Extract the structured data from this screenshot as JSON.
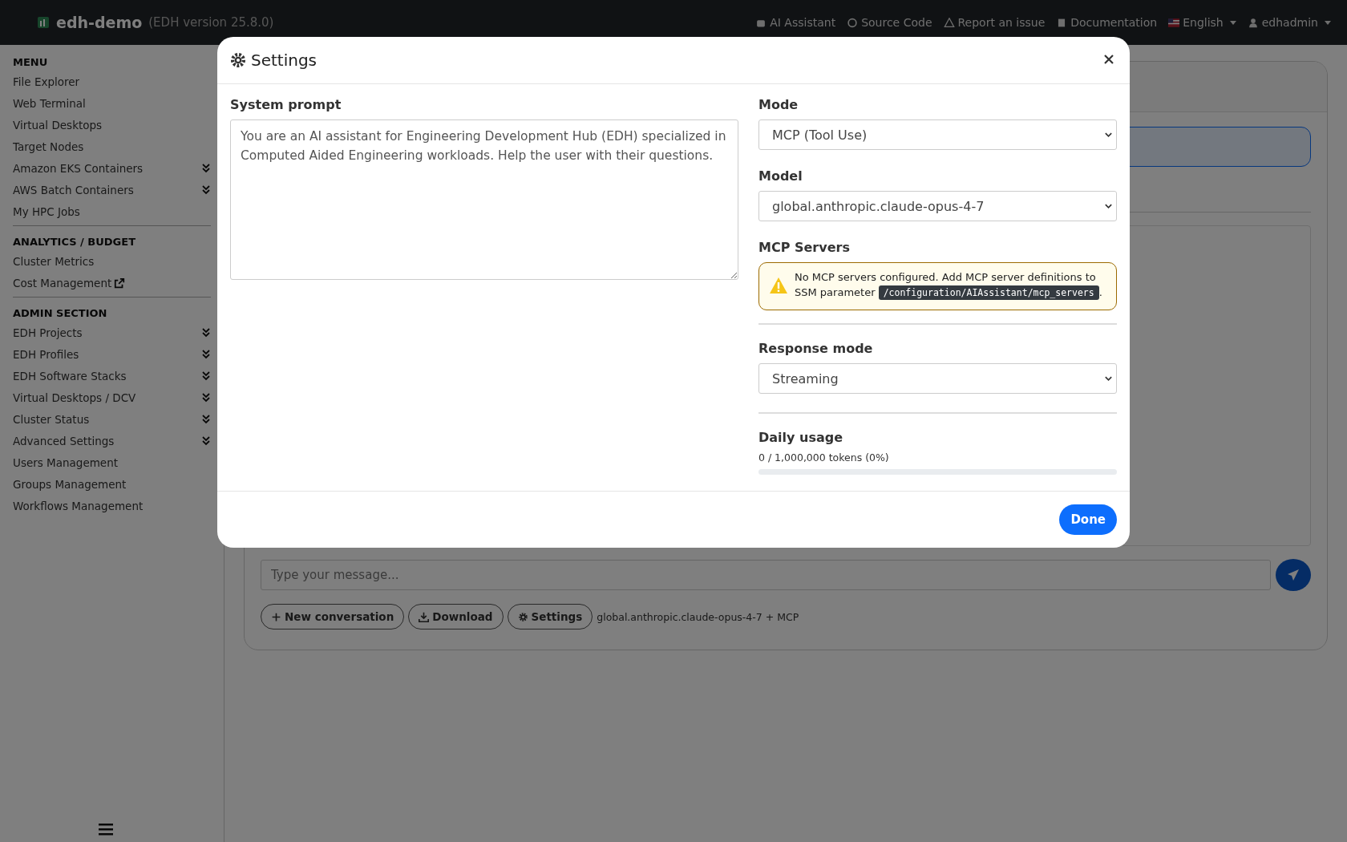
{
  "navbar": {
    "brand": "edh-demo",
    "version": "(EDH version 25.8.0)",
    "links": [
      {
        "label": "AI Assistant"
      },
      {
        "label": "Source Code"
      },
      {
        "label": "Report an issue"
      },
      {
        "label": "Documentation"
      }
    ],
    "language": "English",
    "user": "edhadmin"
  },
  "sidebar": {
    "sections": [
      {
        "title": "MENU",
        "items": [
          {
            "label": "File Explorer",
            "expandable": false,
            "external": false
          },
          {
            "label": "Web Terminal",
            "expandable": false,
            "external": false
          },
          {
            "label": "Virtual Desktops",
            "expandable": false,
            "external": false
          },
          {
            "label": "Target Nodes",
            "expandable": false,
            "external": false
          },
          {
            "label": "Amazon EKS Containers",
            "expandable": true,
            "external": false
          },
          {
            "label": "AWS Batch Containers",
            "expandable": true,
            "external": false
          },
          {
            "label": "My HPC Jobs",
            "expandable": false,
            "external": false
          }
        ]
      },
      {
        "title": "ANALYTICS / BUDGET",
        "items": [
          {
            "label": "Cluster Metrics",
            "expandable": false,
            "external": false
          },
          {
            "label": "Cost Management",
            "expandable": false,
            "external": true
          }
        ]
      },
      {
        "title": "ADMIN SECTION",
        "items": [
          {
            "label": "EDH Projects",
            "expandable": true,
            "external": false
          },
          {
            "label": "EDH Profiles",
            "expandable": true,
            "external": false
          },
          {
            "label": "EDH Software Stacks",
            "expandable": true,
            "external": false
          },
          {
            "label": "Virtual Desktops / DCV",
            "expandable": true,
            "external": false
          },
          {
            "label": "Cluster Status",
            "expandable": true,
            "external": false
          },
          {
            "label": "Advanced Settings",
            "expandable": true,
            "external": false
          },
          {
            "label": "Users Management",
            "expandable": false,
            "external": false
          },
          {
            "label": "Groups Management",
            "expandable": false,
            "external": false
          },
          {
            "label": "Workflows Management",
            "expandable": false,
            "external": false
          }
        ]
      }
    ]
  },
  "chat": {
    "placeholder": "Type your message...",
    "buttons": [
      {
        "label": "New conversation"
      },
      {
        "label": "Download"
      },
      {
        "label": "Settings"
      }
    ],
    "model_info": "global.anthropic.claude-opus-4-7 + MCP"
  },
  "dialog": {
    "title": "Settings",
    "system_prompt": {
      "label": "System prompt",
      "value": "You are an AI assistant for Engineering Development Hub (EDH) specialized in Computed Aided Engineering workloads. Help the user with their questions."
    },
    "mode": {
      "label": "Mode",
      "value": "MCP (Tool Use)"
    },
    "model": {
      "label": "Model",
      "value": "global.anthropic.claude-opus-4-7"
    },
    "mcp_servers": {
      "label": "MCP Servers",
      "warning": "No MCP servers configured. Add MCP server definitions to SSM parameter",
      "code": "/configuration/AIAssistant/mcp_servers",
      "suffix": "."
    },
    "response_mode": {
      "label": "Response mode",
      "value": "Streaming"
    },
    "daily_usage": {
      "label": "Daily usage",
      "reading": "0 / 1,000,000 tokens (0%)",
      "level": 0
    },
    "done": "Done"
  }
}
